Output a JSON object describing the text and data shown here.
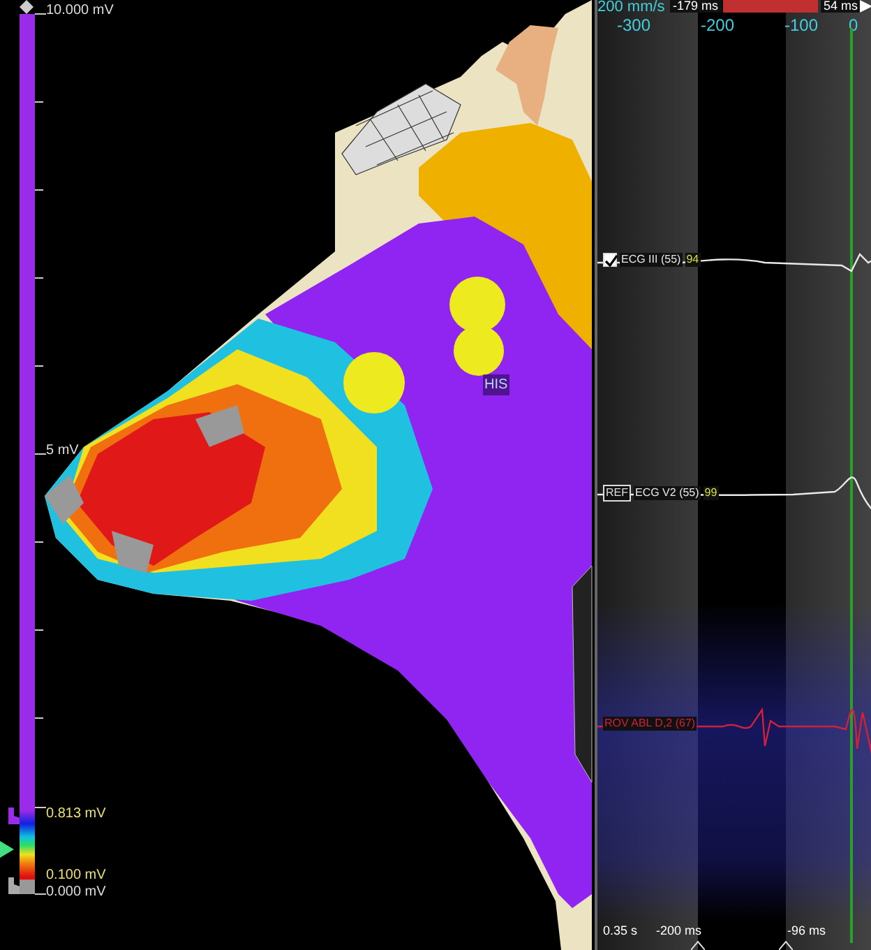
{
  "scale": {
    "max_label": "10.000 mV",
    "mid_label": "5 mV",
    "upper_threshold": "0.813 mV",
    "lower_threshold": "0.100 mV",
    "min_label": "0.000 mV"
  },
  "map": {
    "label": "HIS"
  },
  "timeline": {
    "speed": "200 mm/s",
    "cursor_left": "-179 ms",
    "cursor_right": "54 ms",
    "ticks": [
      "-300",
      "-200",
      "-100",
      "0"
    ]
  },
  "channels": [
    {
      "kind": "checkbox",
      "checked": true,
      "label": "ECG III (55)",
      "value": "94",
      "color": "#e8e8e8"
    },
    {
      "kind": "ref",
      "badge": "REF",
      "label": "ECG V2 (55)",
      "value": "99",
      "color": "#e8e8e8"
    },
    {
      "kind": "plain",
      "label": "ROV ABL D,2 (67)",
      "color": "#d0203c"
    }
  ],
  "footer": {
    "duration": "0.35 s",
    "window_start": "-200 ms",
    "window_end": "-96 ms"
  }
}
